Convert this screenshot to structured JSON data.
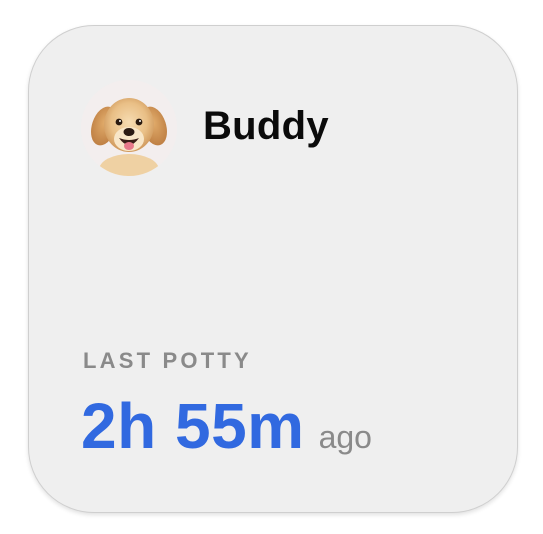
{
  "widget": {
    "pet_name": "Buddy",
    "avatar_icon": "golden-retriever-puppy-photo",
    "section_label": "LAST POTTY",
    "elapsed_time": "2h 55m",
    "elapsed_suffix": "ago"
  },
  "colors": {
    "card_background": "#efefef",
    "accent_blue": "#3169e0",
    "label_gray": "#8a8a8a",
    "name_black": "#0b0b0b"
  }
}
